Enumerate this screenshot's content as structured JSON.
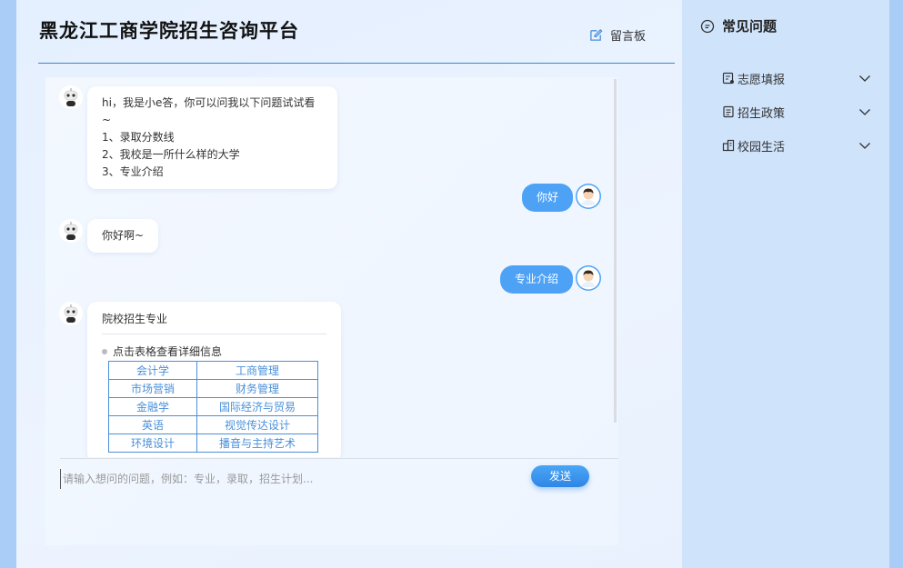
{
  "header": {
    "title": "黑龙江工商学院招生咨询平台",
    "board_label": "留言板"
  },
  "chat": {
    "welcome_lines": [
      "hi，我是小e答，你可以问我以下问题试试看~",
      "1、录取分数线",
      "2、我校是一所什么样的大学",
      "3、专业介绍"
    ],
    "user_msg_1": "你好",
    "bot_reply_1": "你好啊~",
    "user_msg_2": "专业介绍",
    "majors_card": {
      "title": "院校招生专业",
      "hint": "点击表格查看详细信息",
      "rows": [
        [
          "会计学",
          "工商管理"
        ],
        [
          "市场营销",
          "财务管理"
        ],
        [
          "金融学",
          "国际经济与贸易"
        ],
        [
          "英语",
          "视觉传达设计"
        ],
        [
          "环境设计",
          "播音与主持艺术"
        ]
      ]
    },
    "input_placeholder": "请输入想问的问题，例如：专业，录取，招生计划...",
    "send_label": "发送"
  },
  "sidebar": {
    "title": "常见问题",
    "items": [
      {
        "label": "志愿填报",
        "icon": "form-icon"
      },
      {
        "label": "招生政策",
        "icon": "document-icon"
      },
      {
        "label": "校园生活",
        "icon": "building-icon"
      }
    ]
  }
}
